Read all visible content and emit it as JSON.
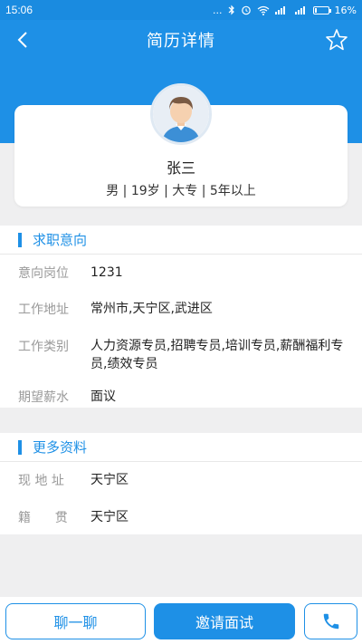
{
  "status_bar": {
    "time": "15:06",
    "dots": "...",
    "battery_text": "16%",
    "battery_level": 0.16
  },
  "nav": {
    "title": "简历详情",
    "back_icon": "chevron-left-icon",
    "favorite_icon": "star-outline-icon"
  },
  "profile": {
    "name": "张三",
    "summary": "男 | 19岁 | 大专 | 5年以上"
  },
  "job_intent": {
    "section_title": "求职意向",
    "rows": [
      {
        "label": "意向岗位",
        "value": "1231"
      },
      {
        "label": "工作地址",
        "value": "常州市,天宁区,武进区"
      },
      {
        "label": "工作类别",
        "value": "人力资源专员,招聘专员,培训专员,薪酬福利专员,绩效专员"
      },
      {
        "label": "期望薪水",
        "value": "面议"
      }
    ]
  },
  "more_info": {
    "section_title": "更多资料",
    "rows": [
      {
        "label": "现 地 址",
        "value": "天宁区"
      },
      {
        "label": "籍      贯",
        "value": "天宁区"
      }
    ]
  },
  "actions": {
    "chat_label": "聊一聊",
    "invite_label": "邀请面试",
    "phone_icon": "phone-icon"
  },
  "colors": {
    "primary": "#1e90e6",
    "background": "#efeff0"
  }
}
